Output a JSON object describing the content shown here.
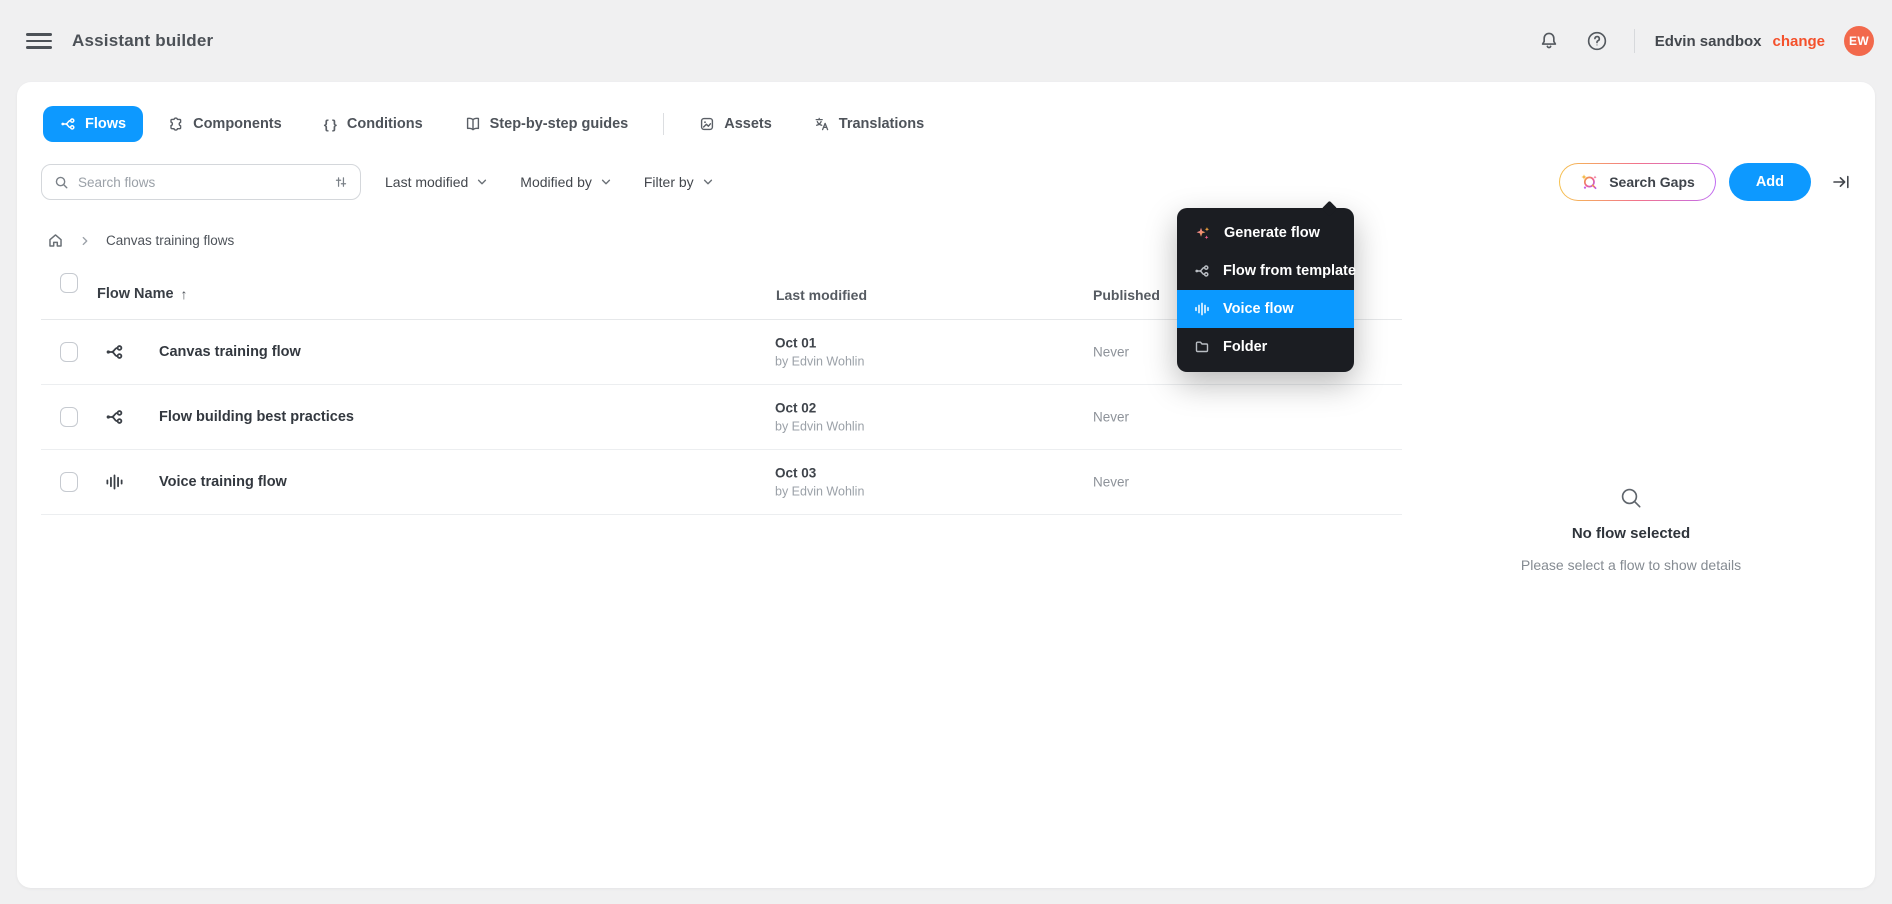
{
  "app": {
    "title": "Assistant builder"
  },
  "header": {
    "workspace": "Edvin sandbox",
    "change_label": "change",
    "avatar_initials": "EW",
    "icons": [
      "menu-icon",
      "bell-icon",
      "help-icon"
    ]
  },
  "tabs": [
    {
      "label": "Flows",
      "icon": "flow-icon",
      "active": true
    },
    {
      "label": "Components",
      "icon": "puzzle-icon",
      "active": false
    },
    {
      "label": "Conditions",
      "icon": "braces-icon",
      "active": false
    },
    {
      "label": "Step-by-step guides",
      "icon": "book-icon",
      "active": false
    },
    {
      "label": "Assets",
      "icon": "image-icon",
      "active": false
    },
    {
      "label": "Translations",
      "icon": "translate-icon",
      "active": false
    }
  ],
  "toolbar": {
    "search_placeholder": "Search flows",
    "search_icon": "search-icon",
    "search_settings_icon": "sliders-icon",
    "sort_dropdown": "Last modified",
    "modified_by_dropdown": "Modified by",
    "filter_dropdown": "Filter by",
    "search_gaps_label": "Search Gaps",
    "search_gaps_icon": "sparkle-magnifier-icon",
    "add_label": "Add",
    "collapse_icon": "arrow-to-bar-icon"
  },
  "breadcrumb": {
    "home_icon": "home-icon",
    "current": "Canvas training flows"
  },
  "table": {
    "headers": {
      "name": "Flow Name",
      "modified": "Last modified",
      "published": "Published"
    },
    "sort_indicator": "↑",
    "rows": [
      {
        "name": "Canvas training flow",
        "icon": "flow-icon",
        "date": "Oct 01",
        "by": "by Edvin Wohlin",
        "published": "Never"
      },
      {
        "name": "Flow building best practices",
        "icon": "flow-icon",
        "date": "Oct 02",
        "by": "by Edvin Wohlin",
        "published": "Never"
      },
      {
        "name": "Voice training flow",
        "icon": "voice-icon",
        "date": "Oct 03",
        "by": "by Edvin Wohlin",
        "published": "Never"
      }
    ]
  },
  "add_menu": {
    "items": [
      {
        "label": "Generate flow",
        "icon": "sparkles-icon",
        "highlighted": false
      },
      {
        "label": "Flow from template",
        "icon": "flow-icon",
        "highlighted": false
      },
      {
        "label": "Voice flow",
        "icon": "voice-icon",
        "highlighted": true
      },
      {
        "label": "Folder",
        "icon": "folder-icon",
        "highlighted": false
      }
    ]
  },
  "empty_state": {
    "icon": "search-icon",
    "title": "No flow selected",
    "subtitle": "Please select a flow to show details"
  },
  "colors": {
    "accent_blue": "#0d99ff",
    "menu_highlight_blue": "#0b99ff",
    "change_link_orange": "#f4512c",
    "avatar_orange": "#f2694c",
    "menu_background": "#1b1d22"
  }
}
